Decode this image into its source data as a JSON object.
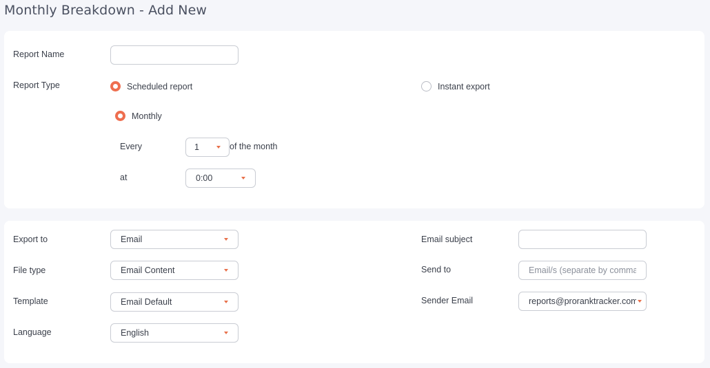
{
  "page": {
    "title": "Monthly Breakdown - Add New"
  },
  "report": {
    "name_label": "Report Name",
    "name_value": "",
    "type_label": "Report Type",
    "type_options": [
      {
        "label": "Scheduled report",
        "selected": true
      },
      {
        "label": "Instant export",
        "selected": false
      }
    ],
    "frequency": {
      "label": "Monthly",
      "selected": true
    },
    "every_label": "Every",
    "day_value": "1",
    "of_month_label": "of the month",
    "at_label": "at",
    "time_value": "0:00"
  },
  "export": {
    "export_to_label": "Export to",
    "export_to_value": "Email",
    "file_type_label": "File type",
    "file_type_value": "Email Content",
    "template_label": "Template",
    "template_value": "Email Default",
    "language_label": "Language",
    "language_value": "English",
    "email_subject_label": "Email subject",
    "email_subject_value": "",
    "send_to_label": "Send to",
    "send_to_placeholder": "Email/s (separate by commas)",
    "sender_email_label": "Sender Email",
    "sender_email_value": "reports@proranktracker.com"
  },
  "colors": {
    "accent": "#ee6e4f",
    "caret": "#e8704a",
    "background": "#f5f6fa",
    "card": "#ffffff",
    "border": "#c9ccd3"
  },
  "icons": {
    "dropdown": "chevron-down-icon",
    "radio": "radio-icon"
  }
}
